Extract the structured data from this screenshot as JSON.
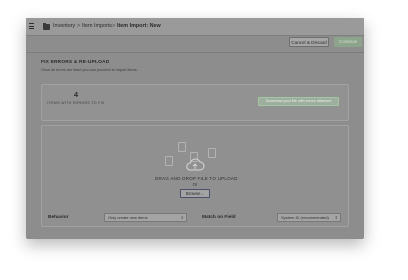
{
  "breadcrumb": {
    "items": [
      "Inventory",
      "Item Imports",
      "Item Import: New"
    ],
    "separator": ">"
  },
  "actions": {
    "cancel_label": "Cancel & Discard",
    "continue_label": "Continue"
  },
  "section": {
    "title": "FIX ERRORS & RE-UPLOAD",
    "subtitle": "Once all errors are fixed you can proceed to import items."
  },
  "errors": {
    "count": "4",
    "label": "ITEMS WITH ERRORS TO FIX",
    "download_label": "Download your file with errors attached"
  },
  "upload": {
    "drop_text": "DRAG AND DROP FILE TO UPLOAD",
    "or_text": "Or",
    "browse_label": "Browse..."
  },
  "settings": {
    "behavior_label": "Behavior",
    "behavior_value": "Only create new items",
    "match_label": "Match on Field",
    "match_value": "System ID (recommended)"
  },
  "colors": {
    "accent_green": "#8ba48b",
    "download_border": "#a3c7a3"
  },
  "icons": [
    "menu-icon",
    "folder-icon",
    "cloud-upload-icon",
    "file-icon",
    "chevron-updown-icon"
  ]
}
